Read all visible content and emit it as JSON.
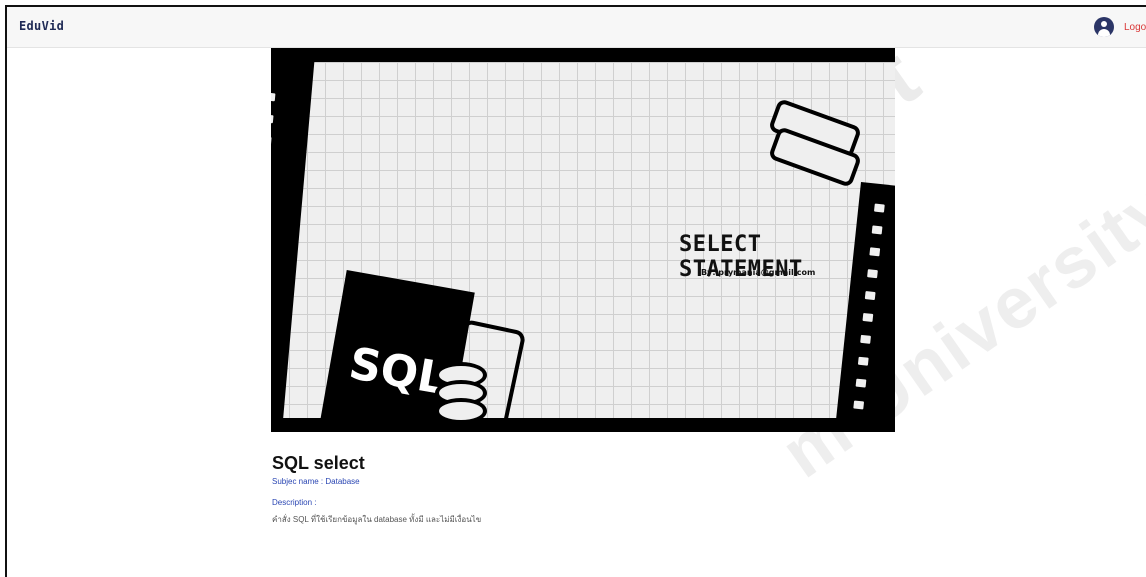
{
  "navbar": {
    "brand": "EduVid",
    "logout_label": "Logout"
  },
  "video": {
    "thumbnail_title": "SELECT STATEMENT",
    "thumbnail_author": "By: prymania@gmail.com",
    "thumbnail_badge": "SQL"
  },
  "content": {
    "title": "SQL select",
    "subject": "Subjec name : Database",
    "description_label": "Description :",
    "description": "คำสั่ง SQL ที่ใช้เรียกข้อมูลใน database ทั้งมี และไม่มีเงื่อนไข"
  },
  "watermark": {
    "line1": "partment",
    "line2": "m University"
  },
  "colors": {
    "brand": "#1f2a55",
    "logout": "#d93636",
    "link": "#2a46b3"
  },
  "icons": {
    "avatar": "user-circle-icon"
  }
}
